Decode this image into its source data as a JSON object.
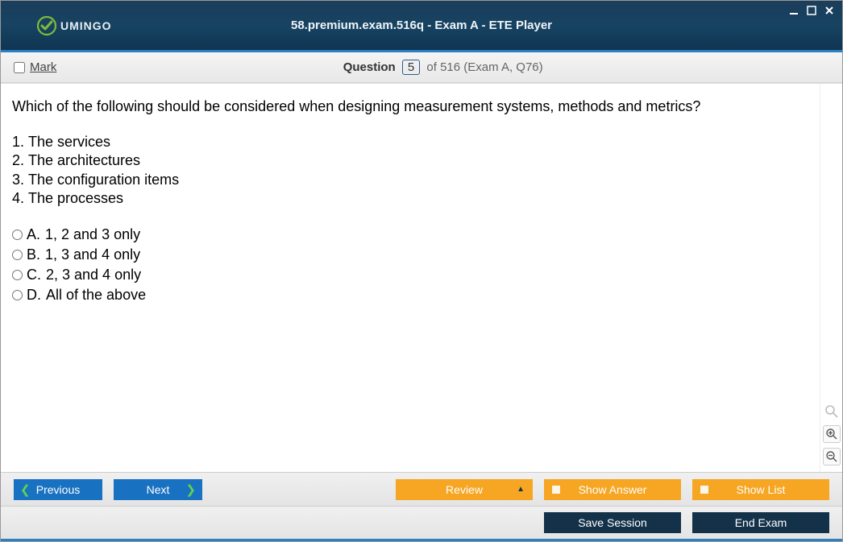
{
  "header": {
    "brand": "UMINGO",
    "title": "58.premium.exam.516q - Exam A - ETE Player"
  },
  "qheader": {
    "mark_label": "Mark",
    "question_label": "Question",
    "current_number": "5",
    "of_text": "of 516 (Exam A, Q76)"
  },
  "question": {
    "stem": "Which of the following should be considered when designing measurement systems, methods and metrics?",
    "items": [
      "The services",
      "The architectures",
      "The configuration items",
      "The processes"
    ],
    "choices": [
      {
        "letter": "A.",
        "text": "1, 2 and 3 only"
      },
      {
        "letter": "B.",
        "text": "1, 3 and 4 only"
      },
      {
        "letter": "C.",
        "text": "2, 3 and 4 only"
      },
      {
        "letter": "D.",
        "text": "All of the above"
      }
    ]
  },
  "nav": {
    "previous": "Previous",
    "next": "Next",
    "review": "Review",
    "show_answer": "Show Answer",
    "show_list": "Show List"
  },
  "end": {
    "save_session": "Save Session",
    "end_exam": "End Exam"
  }
}
